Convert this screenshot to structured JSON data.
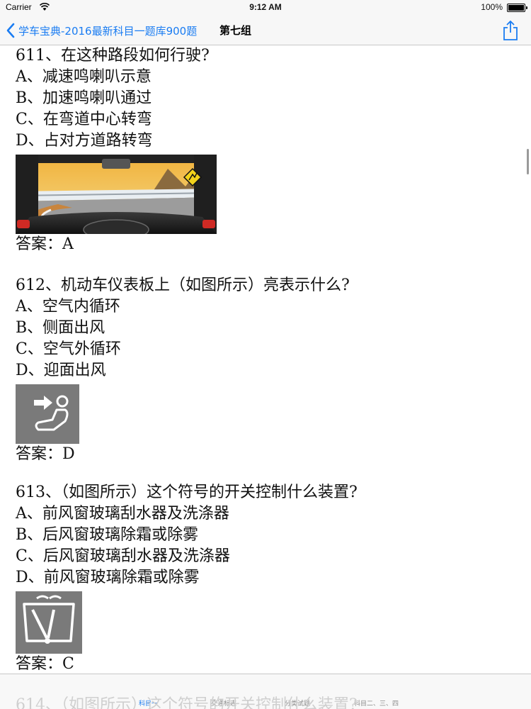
{
  "status_bar": {
    "carrier": "Carrier",
    "time": "9:12 AM",
    "battery": "100%"
  },
  "nav": {
    "back_label": "学车宝典-2016最新科目一题库900题",
    "title": "第七组"
  },
  "questions": [
    {
      "title": "611、在这种路段如何行驶?",
      "options": [
        "A、减速鸣喇叭示意",
        "B、加速鸣喇叭通过",
        "C、在弯道中心转弯",
        "D、占对方道路转弯"
      ],
      "image": "curved-road-photo",
      "answer": "答案：A"
    },
    {
      "title": "612、机动车仪表板上（如图所示）亮表示什么?",
      "options": [
        "A、空气内循环",
        "B、侧面出风",
        "C、空气外循环",
        "D、迎面出风"
      ],
      "image": "face-vent-icon",
      "answer": "答案：D"
    },
    {
      "title": "613、（如图所示）这个符号的开关控制什么装置?",
      "options": [
        "A、前风窗玻璃刮水器及洗涤器",
        "B、后风窗玻璃除霜或除雾",
        "C、后风窗玻璃刮水器及洗涤器",
        "D、前风窗玻璃除霜或除雾"
      ],
      "image": "windshield-wiper-icon",
      "answer": "答案：C"
    }
  ],
  "ghost_line": "614、（如图所示）这个符号的开关控制什么装置?",
  "tabs": [
    {
      "label": "科目一",
      "active": true
    },
    {
      "label": "交通标志",
      "active": false
    },
    {
      "label": "分类试题",
      "active": false
    },
    {
      "label": "科目二、三、四",
      "active": false
    }
  ],
  "colors": {
    "accent": "#1a7cf2",
    "bar_background": "#f7f7f7",
    "icon_gray": "#7a7a7a"
  }
}
